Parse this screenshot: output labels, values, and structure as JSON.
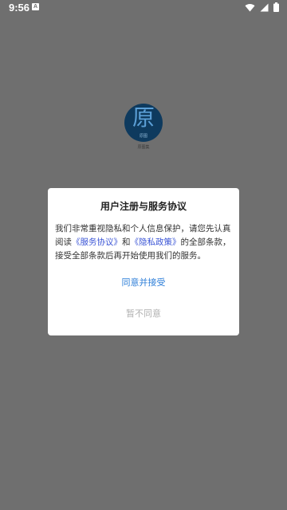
{
  "status_bar": {
    "time": "9:56",
    "notification_glyph": "A",
    "icons": [
      "wifi-icon",
      "signal-icon",
      "battery-icon"
    ]
  },
  "splash": {
    "logo_char": "原",
    "logo_sub": "原图",
    "caption": "原图集"
  },
  "dialog": {
    "title": "用户注册与服务协议",
    "body_part1": "我们非常重视隐私和个人信息保护，请您先认真阅读",
    "service_link": "《服务协议》",
    "body_part2": "和",
    "privacy_link": "《隐私政策》",
    "body_part3": "的全部条款，接受全部条款后再开始使用我们的服务。",
    "agree_label": "同意并接受",
    "disagree_label": "暂不同意"
  },
  "colors": {
    "overlay": "#6f6f6f",
    "link": "#3b55d6",
    "primary_button": "#2f7fd8",
    "secondary_button": "#b0b0b0"
  }
}
